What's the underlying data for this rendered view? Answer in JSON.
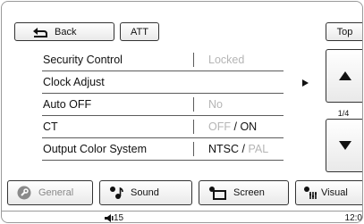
{
  "header": {
    "back_label": "Back",
    "att_label": "ATT",
    "top_label": "Top"
  },
  "menu": {
    "rows": [
      {
        "label": "Security Control",
        "value": "Locked"
      },
      {
        "label": "Clock Adjust"
      },
      {
        "label": "Auto OFF",
        "value": "No"
      },
      {
        "label": "CT",
        "value_off": "OFF",
        "separator": "/",
        "value_on": "ON"
      },
      {
        "label": "Output Color System",
        "value_ntsc": "NTSC",
        "separator": "/",
        "value_pal": "PAL"
      }
    ]
  },
  "pager": {
    "indicator": "1/4"
  },
  "tabs": [
    {
      "label": "General",
      "icon": "wrench-icon"
    },
    {
      "label": "Sound",
      "icon": "music-note-icon"
    },
    {
      "label": "Screen",
      "icon": "screen-icon"
    },
    {
      "label": "Visual",
      "icon": "visual-icon"
    }
  ],
  "status": {
    "volume": "15",
    "clock": "12:0"
  },
  "colors": {
    "dim_text": "#b5b5b5",
    "border": "#333333"
  }
}
